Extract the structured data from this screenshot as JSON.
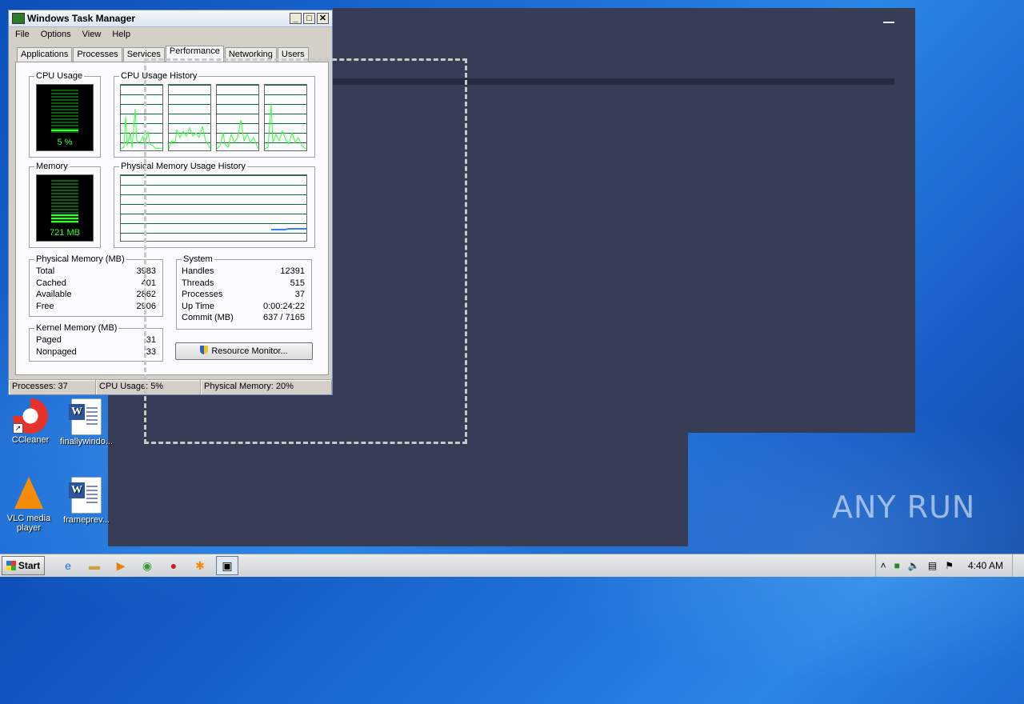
{
  "task_manager": {
    "title": "Windows Task Manager",
    "menu": [
      "File",
      "Options",
      "View",
      "Help"
    ],
    "tabs": [
      "Applications",
      "Processes",
      "Services",
      "Performance",
      "Networking",
      "Users"
    ],
    "active_tab": "Performance",
    "cpu_usage": {
      "label": "CPU Usage",
      "value": "5 %",
      "level": 0.05
    },
    "cpu_history": {
      "label": "CPU Usage History",
      "cores": 4
    },
    "memory": {
      "label": "Memory",
      "value": "721 MB",
      "level": 0.2
    },
    "memory_history": {
      "label": "Physical Memory Usage History"
    },
    "physical_memory": {
      "label": "Physical Memory (MB)",
      "rows": [
        {
          "name": "Total",
          "value": "3983"
        },
        {
          "name": "Cached",
          "value": "401"
        },
        {
          "name": "Available",
          "value": "2862"
        },
        {
          "name": "Free",
          "value": "2906"
        }
      ]
    },
    "kernel_memory": {
      "label": "Kernel Memory (MB)",
      "rows": [
        {
          "name": "Paged",
          "value": "31"
        },
        {
          "name": "Nonpaged",
          "value": "33"
        }
      ]
    },
    "system": {
      "label": "System",
      "rows": [
        {
          "name": "Handles",
          "value": "12391"
        },
        {
          "name": "Threads",
          "value": "515"
        },
        {
          "name": "Processes",
          "value": "37"
        },
        {
          "name": "Up Time",
          "value": "0:00:24:22"
        },
        {
          "name": "Commit (MB)",
          "value": "637 / 7165"
        }
      ]
    },
    "resource_monitor_button": "Resource Monitor...",
    "status": {
      "processes": "Processes: 37",
      "cpu": "CPU Usage: 5%",
      "memory": "Physical Memory: 20%"
    }
  },
  "desktop_icons": [
    {
      "label": "CCleaner",
      "icon": "ccleaner-icon"
    },
    {
      "label": "finallywindo...",
      "icon": "word-doc-icon"
    },
    {
      "label": "VLC media player",
      "icon": "vlc-icon"
    },
    {
      "label": "frameprev...",
      "icon": "word-doc-icon"
    }
  ],
  "taskbar": {
    "start_label": "Start",
    "apps": [
      "ie-icon",
      "explorer-icon",
      "media-player-icon",
      "chrome-icon",
      "opera-icon",
      "avast-icon",
      "task-manager-icon"
    ],
    "clock": "4:40 AM"
  },
  "watermark": "ANY RUN",
  "colors": {
    "graph_line": "#37ff37",
    "memory_line": "#3a7bff",
    "dark_window": "#363d55",
    "desktop": "#1e6fd6"
  }
}
